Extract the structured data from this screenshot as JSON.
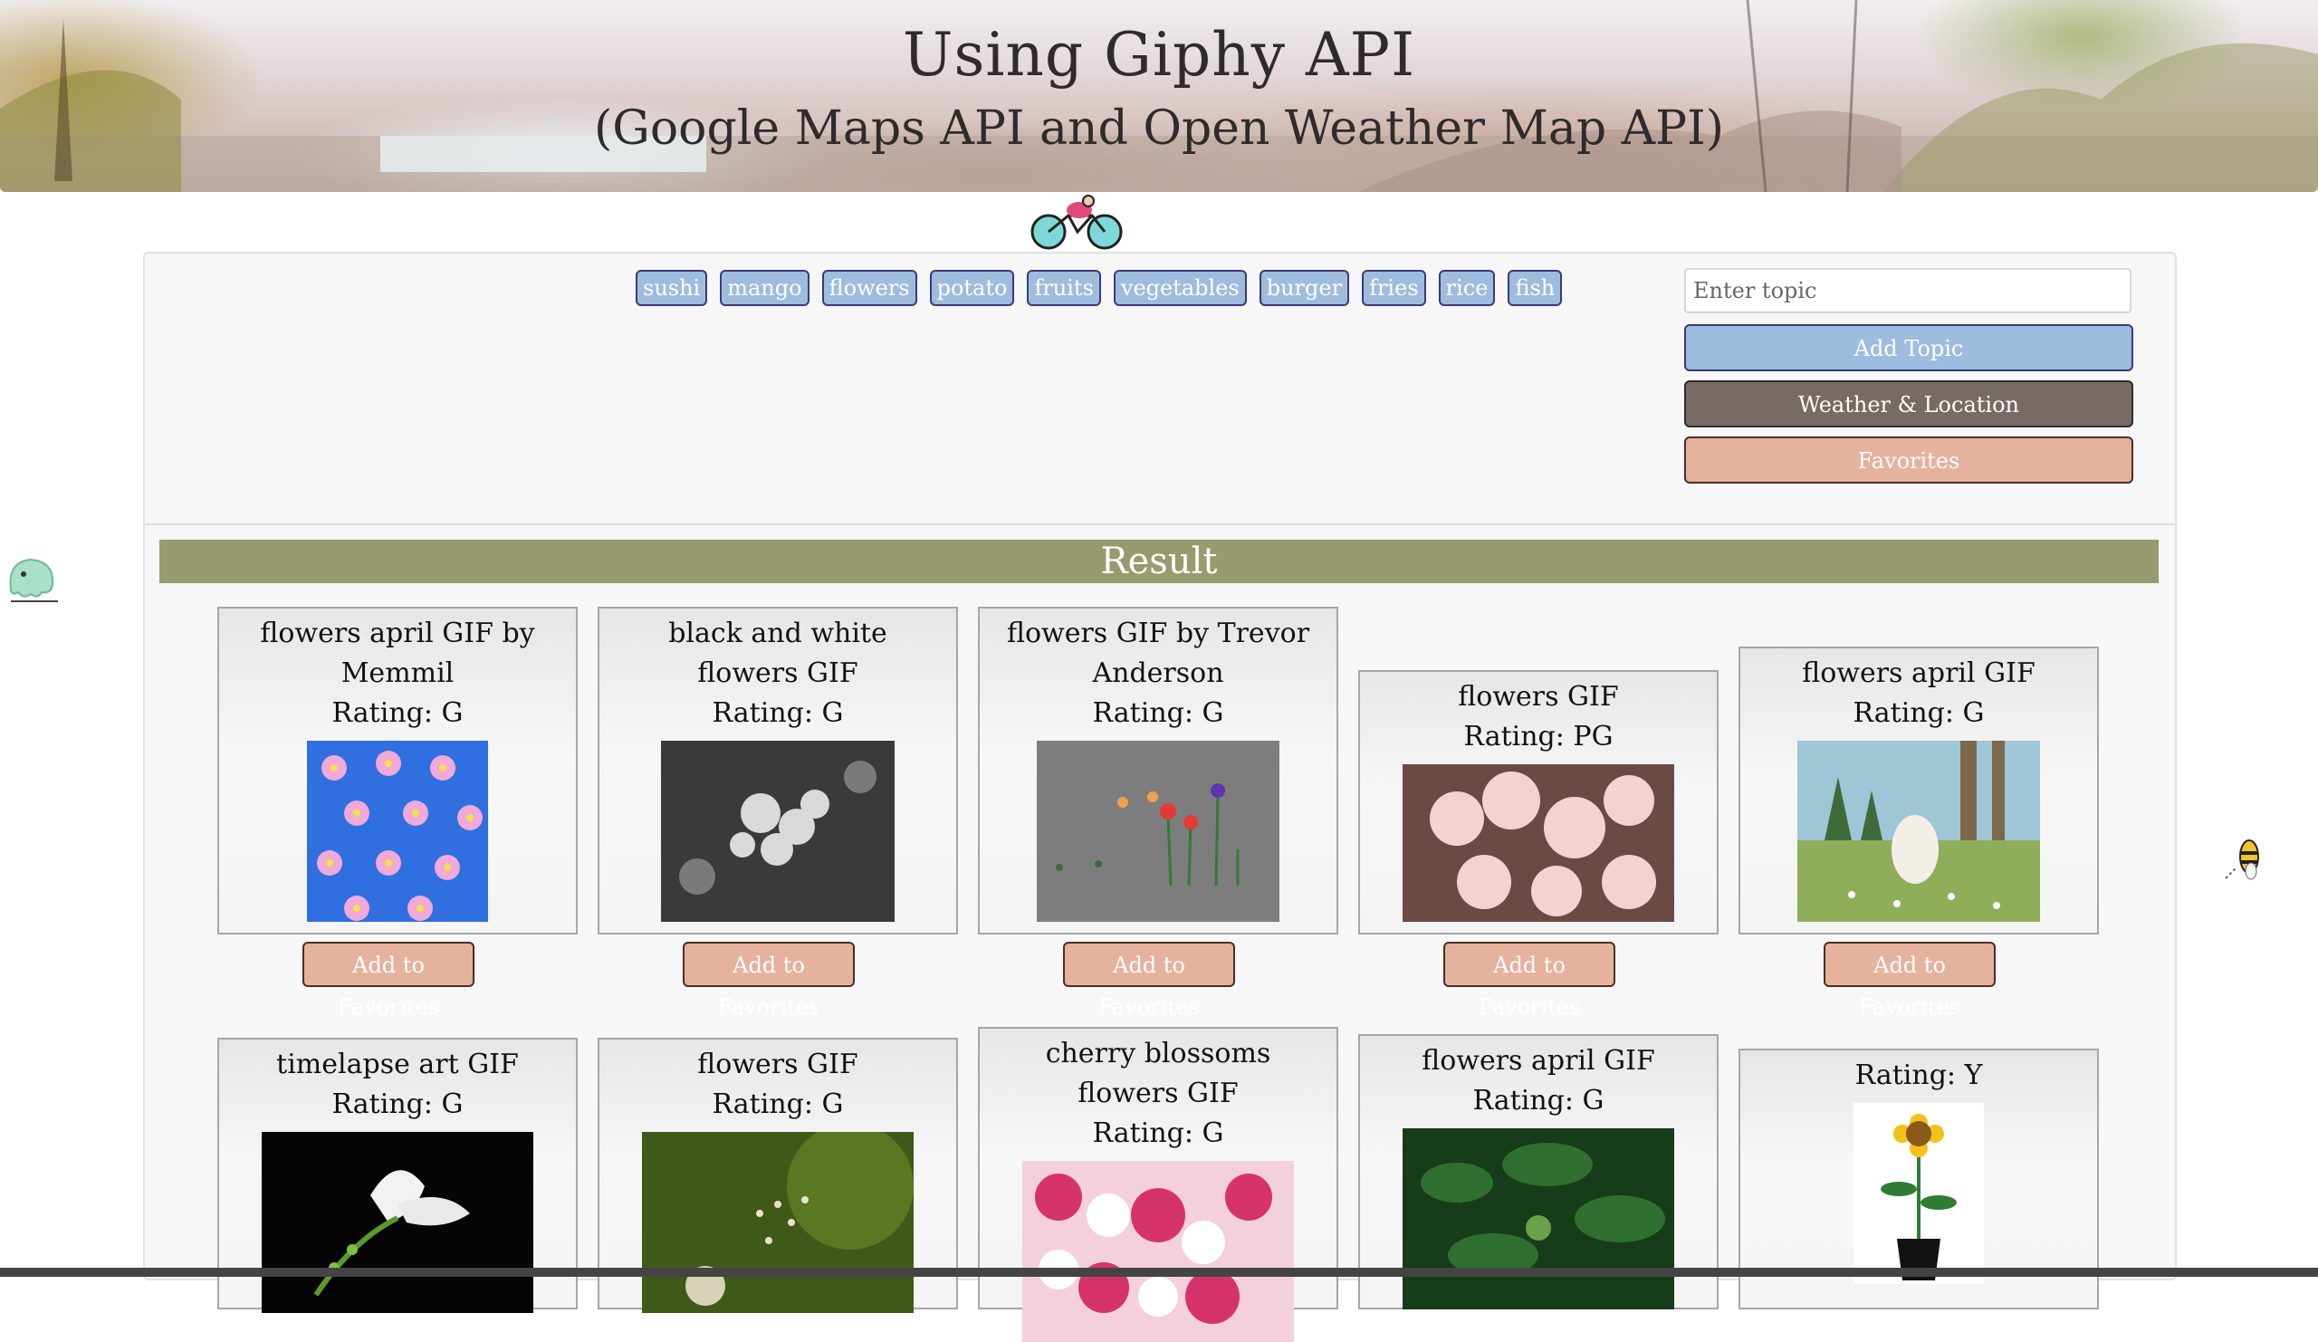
{
  "header": {
    "title": "Using Giphy API",
    "subtitle": "(Google Maps API and Open Weather Map API)"
  },
  "topics": [
    "sushi",
    "mango",
    "flowers",
    "potato",
    "fruits",
    "vegetables",
    "burger",
    "fries",
    "rice",
    "fish"
  ],
  "topic_input": {
    "placeholder": "Enter topic",
    "value": ""
  },
  "buttons": {
    "add_topic": "Add Topic",
    "weather_location": "Weather & Location",
    "favorites": "Favorites",
    "add_to_favorites": "Add to Favorites"
  },
  "result": {
    "heading": "Result"
  },
  "gifs": [
    {
      "title": "flowers april GIF by Memmil",
      "rating": "Rating: G"
    },
    {
      "title": "black and white flowers GIF",
      "rating": "Rating: G"
    },
    {
      "title": "flowers GIF by Trevor Anderson",
      "rating": "Rating: G"
    },
    {
      "title": "flowers GIF",
      "rating": "Rating: PG"
    },
    {
      "title": "flowers april GIF",
      "rating": "Rating: G"
    },
    {
      "title": "timelapse art GIF",
      "rating": "Rating: G"
    },
    {
      "title": "flowers GIF",
      "rating": "Rating: G"
    },
    {
      "title": "cherry blossoms flowers GIF",
      "rating": "Rating: G"
    },
    {
      "title": "flowers april GIF",
      "rating": "Rating: G"
    },
    {
      "title": "",
      "rating": "Rating: Y"
    }
  ],
  "colors": {
    "topic_button": "#9ebcde",
    "weather_button": "#776b66",
    "favorites_button": "#e5b29d",
    "result_bar": "#979b6d",
    "panel": "#f7f7f7"
  }
}
